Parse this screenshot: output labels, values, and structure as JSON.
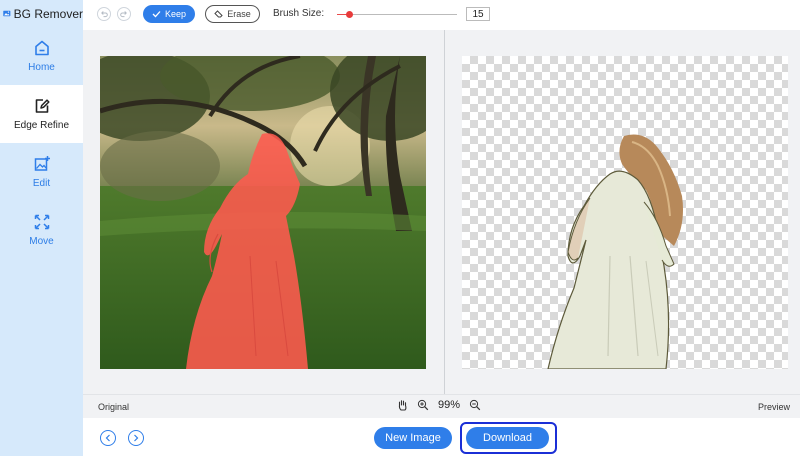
{
  "app": {
    "title": "BG Remover"
  },
  "sidebar": {
    "items": [
      {
        "label": "Home",
        "icon": "home-icon",
        "active": false
      },
      {
        "label": "Edge Refine",
        "icon": "edge-refine-icon",
        "active": true
      },
      {
        "label": "Edit",
        "icon": "edit-image-icon",
        "active": false
      },
      {
        "label": "Move",
        "icon": "move-icon",
        "active": false
      }
    ]
  },
  "toolbar": {
    "keep_label": "Keep",
    "erase_label": "Erase",
    "brush_label": "Brush Size:",
    "brush_value": "15",
    "brush_fraction": 0.1
  },
  "status": {
    "original_label": "Original",
    "preview_label": "Preview",
    "zoom": "99%"
  },
  "footer": {
    "new_image_label": "New Image",
    "download_label": "Download"
  },
  "colors": {
    "accent": "#2f7ee9",
    "sidebar_bg": "#d6e9fb",
    "keep_overlay": "#ff5a4e",
    "highlight_border": "#1b2fd6"
  }
}
